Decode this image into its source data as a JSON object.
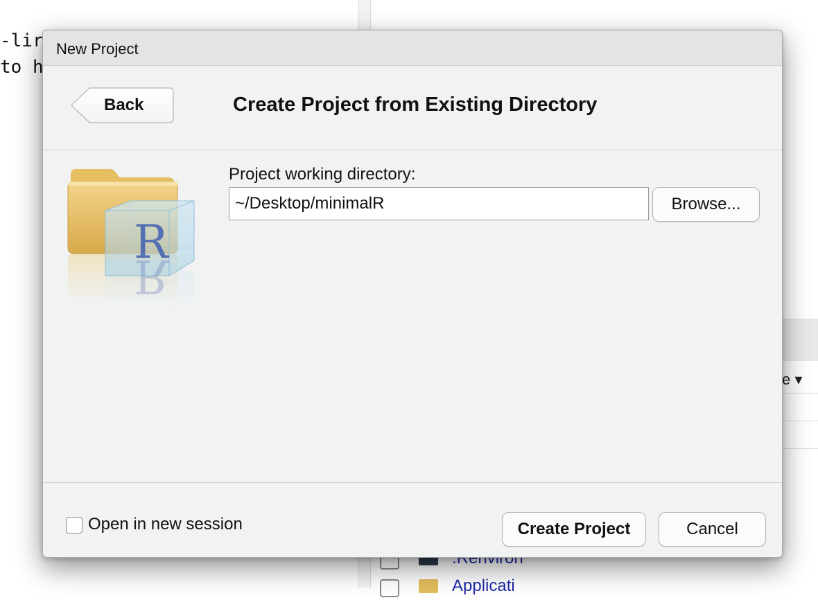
{
  "background": {
    "code_lines": [
      "-lir",
      "to h"
    ],
    "pane_sort_label": "e ▾",
    "files": [
      {
        "name": ".Renviron",
        "icon": "file-icon"
      },
      {
        "name": "Applicati",
        "icon": "folder-icon"
      }
    ]
  },
  "dialog": {
    "window_title": "New Project",
    "back_label": "Back",
    "heading": "Create Project from Existing Directory",
    "icon": "r-project-folder-icon",
    "directory": {
      "label": "Project working directory:",
      "value": "~/Desktop/minimalR"
    },
    "browse_label": "Browse...",
    "open_new_session": {
      "label": "Open in new session",
      "checked": false
    },
    "create_label": "Create Project",
    "cancel_label": "Cancel"
  }
}
